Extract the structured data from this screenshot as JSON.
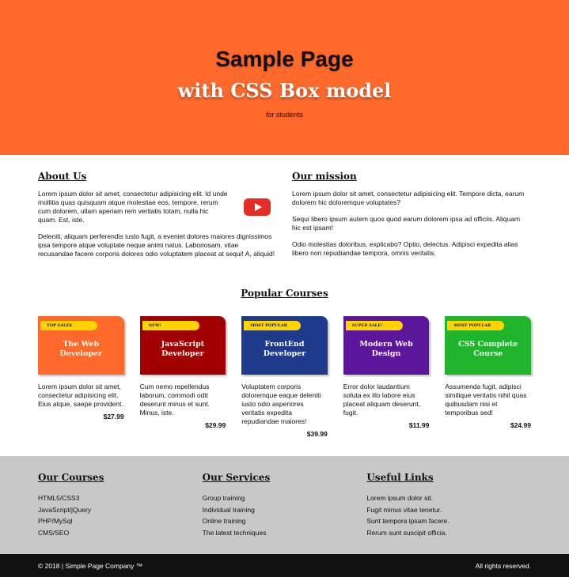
{
  "hero": {
    "title": "Sample Page",
    "subtitle": "with CSS Box model",
    "tagline": "for students",
    "bg_color": "#ff6a2c"
  },
  "about": {
    "title": "About Us",
    "p1": "Lorem ipsum dolor sit amet, consectetur adipisicing elit. Id unde mollitia quas quisquam atque molestiae eos, tempore, rerum cum dolorem, ullam aperiam rem veritatis totam, nulla hic quam. Est, iste.",
    "p2": "Deleniti, aliquam perferendis iusto fugit, a eveniet dolores maiores dignissimos ipsa tempore atque voluptate neque animi natus. Laboriosam, vitae recusandae facere corporis dolores odio voluptatem placeat at sequi! A, aliquid!",
    "video_icon": "youtube-play-icon"
  },
  "mission": {
    "title": "Our mission",
    "p1": "Lorem ipsum dolor sit amet, consectetur adipisicing elit. Tempore dicta, earum dolorem hic doloremque voluptates?",
    "p2": "Sequi libero ipsum autem quos quod earum dolorem ipsa ad officiis. Aliquam hic est ipsam!",
    "p3": "Odio molestias doloribus, explicabo? Optio, delectus. Adipisci expedita alias libero non repudiandae tempora, omnis veritatis."
  },
  "popular": {
    "title": "Popular Courses",
    "courses": [
      {
        "badge": "Top sales",
        "title": "The Web Developer",
        "color": "#ff6a2c",
        "desc": "Lorem ipsum dolor sit amet, consectetur adipisicing elit. Eius atque, saepe provident.",
        "price": "$27.99"
      },
      {
        "badge": "New!",
        "title": "JavaScript Developer",
        "color": "#a00000",
        "desc": "Cum nemo repellendus laborum, commodi odit deserunt minus et sunt. Minus, iste.",
        "price": "$29.99"
      },
      {
        "badge": "Most popular",
        "title": "FrontEnd Developer",
        "color": "#1f3a8a",
        "desc": "Voluptatem corporis doloremque eaque deleniti iusto odio asperiores veritatis expedita repudiandae maiores!",
        "price": "$39.99"
      },
      {
        "badge": "Super sale!",
        "title": "Modern Web Design",
        "color": "#5b169b",
        "desc": "Error dolor laudantium soluta ex illo labore eius placeat aliquam deserunt, fugit.",
        "price": "$11.99"
      },
      {
        "badge": "Most popular",
        "title": "CSS Complete Course",
        "color": "#20b52d",
        "desc": "Assumenda fugit, adipisci similique veritatis nihil quas quibusdam nisi et temporibus sed!",
        "price": "$24.99"
      }
    ]
  },
  "footer": {
    "courses": {
      "title": "Our Courses",
      "items": [
        "HTML5/CSS3",
        "JavaScript/jQuery",
        "PHP/MySql",
        "CMS/SEO"
      ]
    },
    "services": {
      "title": "Our Services",
      "items": [
        "Group training",
        "Individual training",
        "Online training",
        "The latest techniques"
      ]
    },
    "links": {
      "title": "Useful Links",
      "items": [
        "Lorem ipsum dolor sit.",
        "Fugit minus vitae tenetur.",
        "Sunt tempora ipsam facere.",
        "Rerum sunt suscipit officia."
      ]
    },
    "bg_color": "#c8c8c8"
  },
  "bottom": {
    "copyright": "© 2018 | Simple Page Company ™",
    "rights": "All rights reserved."
  }
}
